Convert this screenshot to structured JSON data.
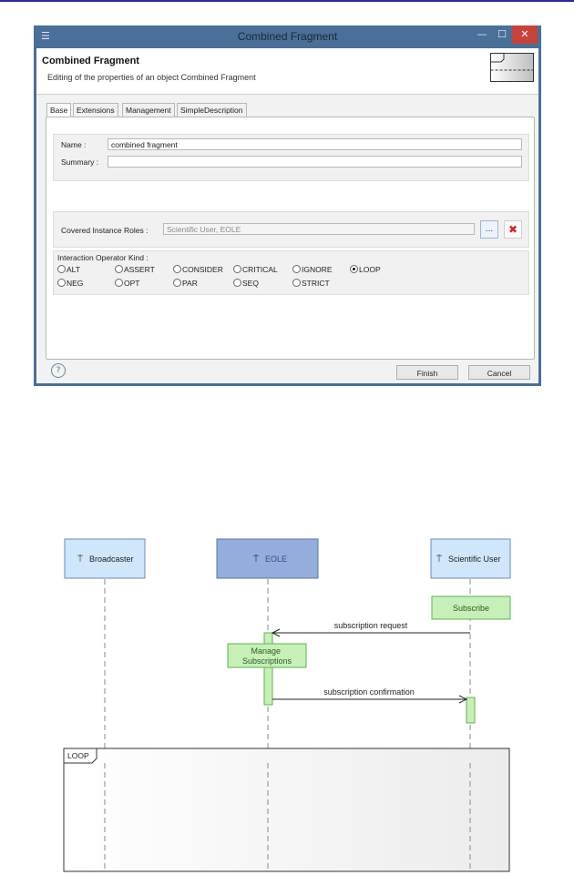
{
  "dialog": {
    "window_title": "Combined Fragment",
    "header_title": "Combined Fragment",
    "header_subtitle": "Editing of the properties of an object Combined Fragment",
    "tabs": [
      {
        "label": "Base",
        "active": true
      },
      {
        "label": "Extensions",
        "active": false
      },
      {
        "label": "Management",
        "active": false
      },
      {
        "label": "SimpleDescription",
        "active": false
      }
    ],
    "name_label": "Name :",
    "name_value": "combined fragment",
    "summary_label": "Summary :",
    "summary_value": "",
    "covered_label": "Covered Instance Roles :",
    "covered_value": "Scientific User, EOLE",
    "browse_label": "...",
    "delete_label": "✖",
    "operator_label": "Interaction Operator Kind :",
    "operators": [
      {
        "label": "ALT",
        "selected": false
      },
      {
        "label": "ASSERT",
        "selected": false
      },
      {
        "label": "CONSIDER",
        "selected": false
      },
      {
        "label": "CRITICAL",
        "selected": false
      },
      {
        "label": "IGNORE",
        "selected": false
      },
      {
        "label": "LOOP",
        "selected": true
      },
      {
        "label": "NEG",
        "selected": false
      },
      {
        "label": "OPT",
        "selected": false
      },
      {
        "label": "PAR",
        "selected": false
      },
      {
        "label": "SEQ",
        "selected": false
      },
      {
        "label": "STRICT",
        "selected": false
      }
    ],
    "help_label": "?",
    "finish_label": "Finish",
    "cancel_label": "Cancel"
  },
  "diagram": {
    "lifelines": [
      {
        "name": "Broadcaster"
      },
      {
        "name": "EOLE"
      },
      {
        "name": "Scientific User"
      }
    ],
    "actions": [
      "Subscribe",
      "Manage Subscriptions"
    ],
    "messages": [
      "subscription request",
      "subscription confirmation"
    ],
    "fragment_label": "LOOP"
  },
  "colors": {
    "lifeline_fill": "#cfe6fb",
    "lifeline_selected_fill": "#93aedc",
    "action_fill": "#c7f0b8",
    "action_border": "#5fb24c",
    "window_frame": "#4a6f98",
    "close_button": "#c7433a"
  }
}
